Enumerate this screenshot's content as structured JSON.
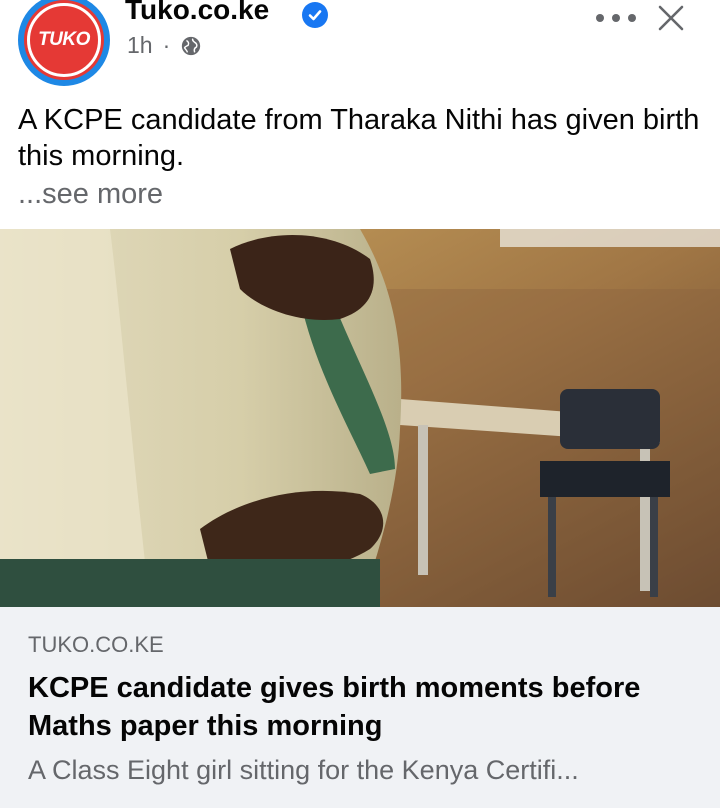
{
  "post": {
    "page_name": "Tuko.co.ke",
    "avatar_text": "TUKO",
    "time": "1h",
    "separator": "·",
    "privacy_icon": "globe-icon",
    "verified_icon": "verified-badge-icon",
    "text": "A KCPE candidate from Tharaka Nithi has given birth this morning.",
    "see_more": "...see more"
  },
  "link_preview": {
    "domain": "TUKO.CO.KE",
    "title": "KCPE candidate gives birth moments before Maths paper this morning",
    "description": "A Class Eight girl sitting for the Kenya Certifi..."
  },
  "colors": {
    "brand_red": "#e53935",
    "brand_blue_ring": "#1e88e5",
    "verified_blue": "#1877f2",
    "secondary_text": "#65676b",
    "card_bg": "#f0f2f5"
  }
}
